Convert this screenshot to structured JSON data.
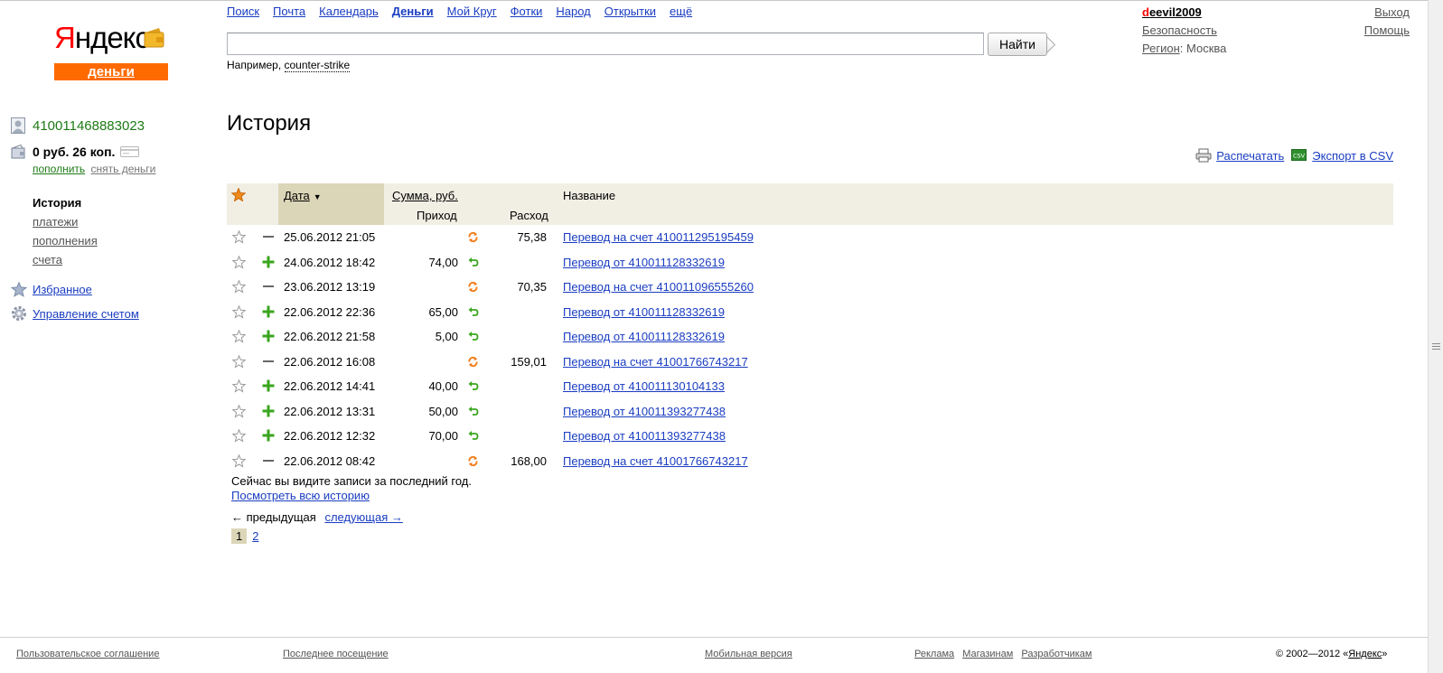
{
  "logo": {
    "word_first": "Я",
    "word_rest": "ндекс",
    "sub": "деньги"
  },
  "nav": {
    "items": [
      "Поиск",
      "Почта",
      "Календарь",
      "Деньги",
      "Мой Круг",
      "Фотки",
      "Народ",
      "Открытки",
      "ещё"
    ],
    "current": "Деньги"
  },
  "search": {
    "value": "",
    "button": "Найти",
    "example_prefix": "Например,",
    "example_query": "counter-strike"
  },
  "user": {
    "name_first": "d",
    "name_rest": "eevil2009",
    "security": "Безопасность",
    "region_label": "Регион",
    "region_value": "Москва",
    "logout": "Выход",
    "help": "Помощь"
  },
  "account": {
    "number": "410011468883023",
    "balance": "0 руб. 26 коп.",
    "topup": "пополнить",
    "withdraw": "снять деньги"
  },
  "menu": {
    "active": "История",
    "items": [
      "платежи",
      "пополнения",
      "счета"
    ],
    "favorites": "Избранное",
    "manage": "Управление счетом"
  },
  "page": {
    "title": "История",
    "print": "Распечатать",
    "export": "Экспорт в CSV"
  },
  "table": {
    "col_date": "Дата",
    "col_sum": "Сумма, руб.",
    "col_in": "Приход",
    "col_out": "Расход",
    "col_name": "Название",
    "rows": [
      {
        "type": "out",
        "date": "25.06.2012 21:05",
        "in": "",
        "out": "75,38",
        "name": "Перевод на счет 410011295195459"
      },
      {
        "type": "in",
        "date": "24.06.2012 18:42",
        "in": "74,00",
        "out": "",
        "name": "Перевод от 410011128332619"
      },
      {
        "type": "out",
        "date": "23.06.2012 13:19",
        "in": "",
        "out": "70,35",
        "name": "Перевод на счет 410011096555260"
      },
      {
        "type": "in",
        "date": "22.06.2012 22:36",
        "in": "65,00",
        "out": "",
        "name": "Перевод от 410011128332619"
      },
      {
        "type": "in",
        "date": "22.06.2012 21:58",
        "in": "5,00",
        "out": "",
        "name": "Перевод от 410011128332619"
      },
      {
        "type": "out",
        "date": "22.06.2012 16:08",
        "in": "",
        "out": "159,01",
        "name": "Перевод на счет 41001766743217"
      },
      {
        "type": "in",
        "date": "22.06.2012 14:41",
        "in": "40,00",
        "out": "",
        "name": "Перевод от 410011130104133"
      },
      {
        "type": "in",
        "date": "22.06.2012 13:31",
        "in": "50,00",
        "out": "",
        "name": "Перевод от 410011393277438"
      },
      {
        "type": "in",
        "date": "22.06.2012 12:32",
        "in": "70,00",
        "out": "",
        "name": "Перевод от 410011393277438"
      },
      {
        "type": "out",
        "date": "22.06.2012 08:42",
        "in": "",
        "out": "168,00",
        "name": "Перевод на счет 41001766743217"
      }
    ]
  },
  "note": {
    "text": "Сейчас вы видите записи за последний год.",
    "link": "Посмотреть всю историю"
  },
  "pager": {
    "prev": "← предыдущая",
    "next": "следующая →",
    "pages": [
      "1",
      "2"
    ],
    "current": "1"
  },
  "footer": {
    "agreement": "Пользовательское соглашение",
    "last_visit": "Последнее посещение",
    "mobile": "Мобильная версия",
    "ads": "Реклама",
    "shops": "Магазинам",
    "devs": "Разработчикам",
    "copyright_prefix": "© 2002—2012 «",
    "copyright_link": "Яндекс",
    "copyright_suffix": "»"
  },
  "colors": {
    "link": "#1a3dc1",
    "green": "#1d7a15",
    "orange": "#ff6a00",
    "header_bg": "#f1efe4",
    "sorted_bg": "#dcd6b8"
  }
}
